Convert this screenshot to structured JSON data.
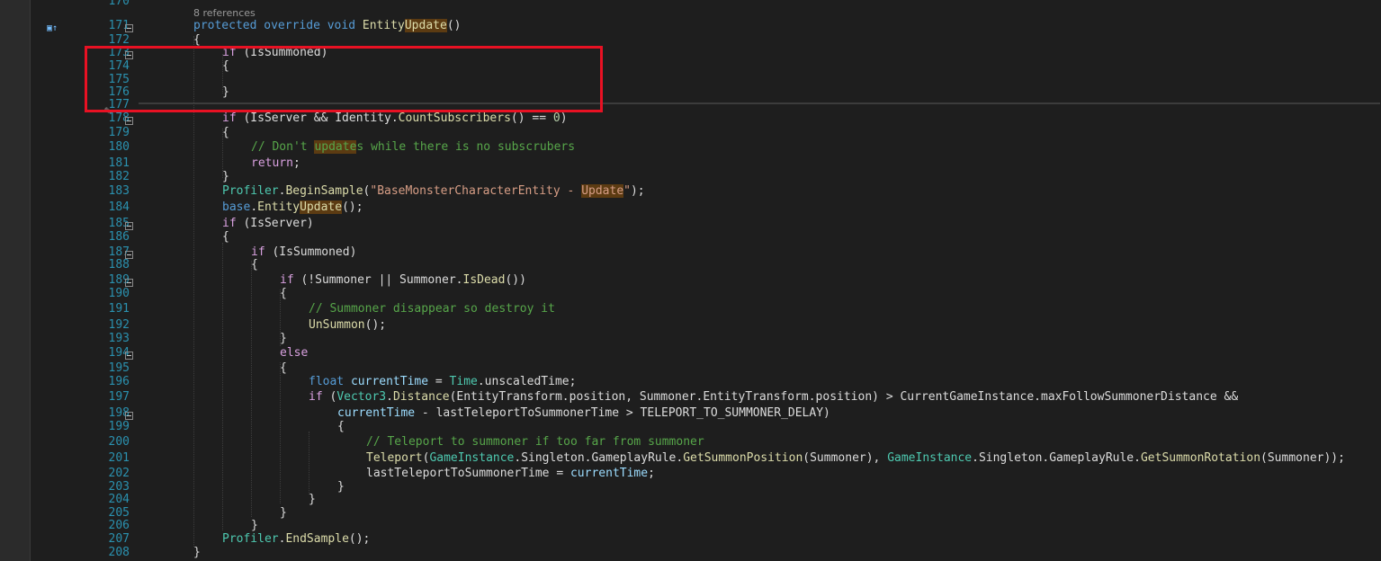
{
  "references": "8 references",
  "lines": [
    {
      "num": "170",
      "segs": []
    },
    {
      "num": "171",
      "segs": [
        [
          "kw",
          "protected"
        ],
        [
          "",
          " "
        ],
        [
          "kw",
          "override"
        ],
        [
          "",
          " "
        ],
        [
          "kw",
          "void"
        ],
        [
          "",
          " "
        ],
        [
          "fn",
          "Entity"
        ],
        [
          "fn hl",
          "Update"
        ],
        [
          "",
          "()"
        ]
      ]
    },
    {
      "num": "172",
      "segs": [
        [
          "",
          "{"
        ]
      ]
    },
    {
      "num": "173",
      "segs": [
        [
          "kc",
          "if"
        ],
        [
          "",
          " (IsSummoned)"
        ]
      ]
    },
    {
      "num": "174",
      "segs": [
        [
          "",
          "{"
        ]
      ]
    },
    {
      "num": "175",
      "segs": []
    },
    {
      "num": "176",
      "segs": [
        [
          "",
          "}"
        ]
      ]
    },
    {
      "num": "177",
      "segs": []
    },
    {
      "num": "178",
      "segs": [
        [
          "kc",
          "if"
        ],
        [
          "",
          " (IsServer && Identity."
        ],
        [
          "fn",
          "CountSubscribers"
        ],
        [
          "",
          "() == "
        ],
        [
          "nm",
          "0"
        ],
        [
          "",
          ")"
        ]
      ]
    },
    {
      "num": "179",
      "segs": [
        [
          "",
          "{"
        ]
      ]
    },
    {
      "num": "180",
      "segs": [
        [
          "cm",
          "// Don't "
        ],
        [
          "cm hl",
          "update"
        ],
        [
          "cm",
          "s while there is no subscrubers"
        ]
      ]
    },
    {
      "num": "181",
      "segs": [
        [
          "kc",
          "return"
        ],
        [
          "",
          ";"
        ]
      ]
    },
    {
      "num": "182",
      "segs": [
        [
          "",
          "}"
        ]
      ]
    },
    {
      "num": "183",
      "segs": [
        [
          "ty",
          "Profiler"
        ],
        [
          "",
          "."
        ],
        [
          "fn",
          "BeginSample"
        ],
        [
          "",
          "("
        ],
        [
          "st",
          "\"BaseMonsterCharacterEntity - "
        ],
        [
          "st hl",
          "Update"
        ],
        [
          "st",
          "\""
        ],
        [
          "",
          ");"
        ]
      ]
    },
    {
      "num": "184",
      "segs": [
        [
          "kw",
          "base"
        ],
        [
          "",
          "."
        ],
        [
          "fn",
          "Entity"
        ],
        [
          "fn hl",
          "Update"
        ],
        [
          "",
          "();"
        ]
      ]
    },
    {
      "num": "185",
      "segs": [
        [
          "kc",
          "if"
        ],
        [
          "",
          " (IsServer)"
        ]
      ]
    },
    {
      "num": "186",
      "segs": [
        [
          "",
          "{"
        ]
      ]
    },
    {
      "num": "187",
      "segs": [
        [
          "kc",
          "if"
        ],
        [
          "",
          " (IsSummoned)"
        ]
      ]
    },
    {
      "num": "188",
      "segs": [
        [
          "",
          "{"
        ]
      ]
    },
    {
      "num": "189",
      "segs": [
        [
          "kc",
          "if"
        ],
        [
          "",
          " (!Summoner || Summoner."
        ],
        [
          "fn",
          "IsDead"
        ],
        [
          "",
          "())"
        ]
      ]
    },
    {
      "num": "190",
      "segs": [
        [
          "",
          "{"
        ]
      ]
    },
    {
      "num": "191",
      "segs": [
        [
          "cm",
          "// Summoner disappear so destroy it"
        ]
      ]
    },
    {
      "num": "192",
      "segs": [
        [
          "fn",
          "UnSummon"
        ],
        [
          "",
          "();"
        ]
      ]
    },
    {
      "num": "193",
      "segs": [
        [
          "",
          "}"
        ]
      ]
    },
    {
      "num": "194",
      "segs": [
        [
          "kc",
          "else"
        ]
      ]
    },
    {
      "num": "195",
      "segs": [
        [
          "",
          "{"
        ]
      ]
    },
    {
      "num": "196",
      "segs": [
        [
          "kw",
          "float"
        ],
        [
          "",
          " "
        ],
        [
          "vr",
          "currentTime"
        ],
        [
          "",
          " = "
        ],
        [
          "ty",
          "Time"
        ],
        [
          "",
          ".unscaledTime;"
        ]
      ]
    },
    {
      "num": "197",
      "segs": [
        [
          "kc",
          "if"
        ],
        [
          "",
          " ("
        ],
        [
          "ty",
          "Vector3"
        ],
        [
          "",
          "."
        ],
        [
          "fn",
          "Distance"
        ],
        [
          "",
          "(EntityTransform.position, Summoner.EntityTransform.position) > CurrentGameInstance.maxFollowSummonerDistance &&"
        ]
      ]
    },
    {
      "num": "198",
      "segs": [
        [
          "vr",
          "currentTime"
        ],
        [
          "",
          " - lastTeleportToSummonerTime > TELEPORT_TO_SUMMONER_DELAY)"
        ]
      ]
    },
    {
      "num": "199",
      "segs": [
        [
          "",
          "{"
        ]
      ]
    },
    {
      "num": "200",
      "segs": [
        [
          "cm",
          "// Teleport to summoner if too far from summoner"
        ]
      ]
    },
    {
      "num": "201",
      "segs": [
        [
          "fn",
          "Teleport"
        ],
        [
          "",
          "("
        ],
        [
          "ty",
          "GameInstance"
        ],
        [
          "",
          ".Singleton.GameplayRule."
        ],
        [
          "fn",
          "GetSummonPosition"
        ],
        [
          "",
          "(Summoner), "
        ],
        [
          "ty",
          "GameInstance"
        ],
        [
          "",
          ".Singleton.GameplayRule."
        ],
        [
          "fn",
          "GetSummonRotation"
        ],
        [
          "",
          "(Summoner));"
        ]
      ]
    },
    {
      "num": "202",
      "segs": [
        [
          "",
          "lastTeleportToSummonerTime = "
        ],
        [
          "vr",
          "currentTime"
        ],
        [
          "",
          ";"
        ]
      ]
    },
    {
      "num": "203",
      "segs": [
        [
          "",
          "}"
        ]
      ]
    },
    {
      "num": "204",
      "segs": [
        [
          "",
          "}"
        ]
      ]
    },
    {
      "num": "205",
      "segs": [
        [
          "",
          "}"
        ]
      ]
    },
    {
      "num": "206",
      "segs": [
        [
          "",
          "}"
        ]
      ]
    },
    {
      "num": "207",
      "segs": [
        [
          "ty",
          "Profiler"
        ],
        [
          "",
          "."
        ],
        [
          "fn",
          "EndSample"
        ],
        [
          "",
          "();"
        ]
      ]
    },
    {
      "num": "208",
      "segs": [
        [
          "",
          "}"
        ]
      ]
    }
  ],
  "colors": {
    "highlight_box": "#e81123",
    "line_number": "#2b91af",
    "keyword": "#569cd6",
    "control": "#d8a0df",
    "type": "#4ec9b0",
    "method": "#dcdcaa",
    "comment": "#57a64a",
    "string": "#d69d85"
  }
}
